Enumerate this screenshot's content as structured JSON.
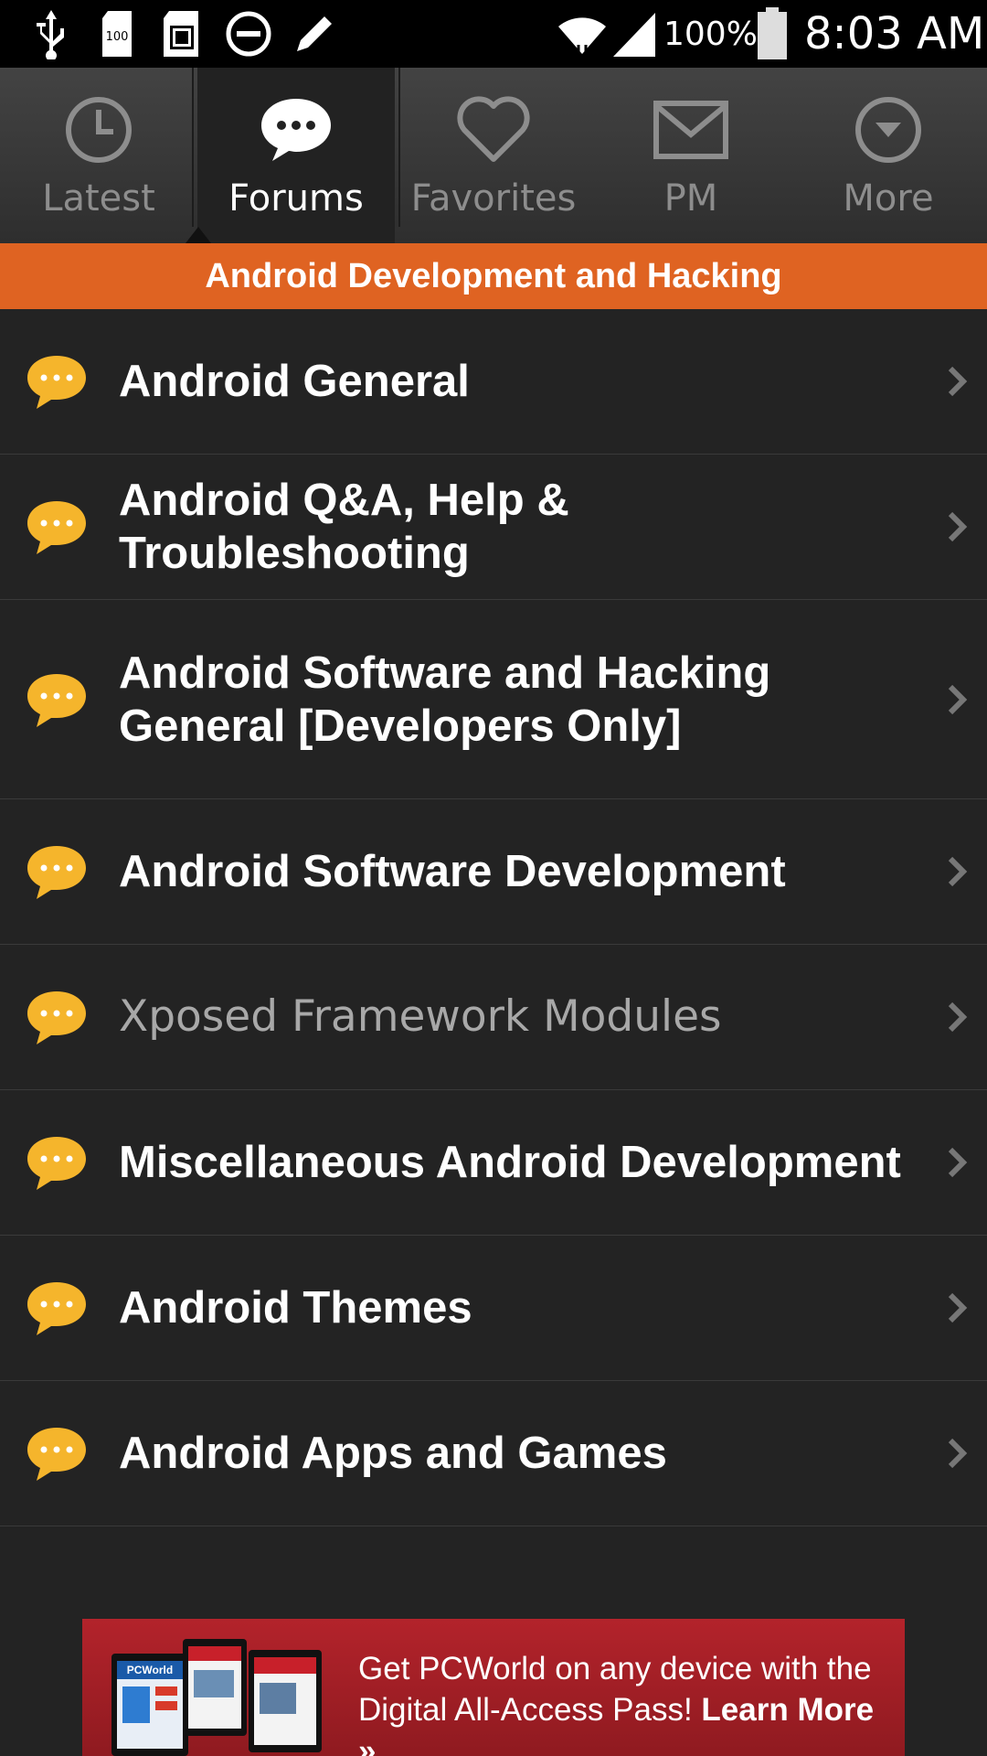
{
  "status_bar": {
    "battery_percent": "100%",
    "time": "8:03 AM",
    "notif_icons": [
      "usb-icon",
      "sd-card-icon",
      "screenshot-icon",
      "do-not-disturb-icon",
      "pencil-icon"
    ],
    "system_icons": [
      "wifi-icon",
      "signal-icon",
      "battery-icon"
    ]
  },
  "tabs": [
    {
      "label": "Latest",
      "icon": "clock-icon",
      "active": false
    },
    {
      "label": "Forums",
      "icon": "chat-bubble-icon",
      "active": true
    },
    {
      "label": "Favorites",
      "icon": "heart-icon",
      "active": false
    },
    {
      "label": "PM",
      "icon": "envelope-icon",
      "active": false
    },
    {
      "label": "More",
      "icon": "dropdown-circle-icon",
      "active": false
    }
  ],
  "section": {
    "title": "Android Development and Hacking"
  },
  "forums": [
    {
      "title": "Android General"
    },
    {
      "title": "Android Q&A, Help & Troubleshooting"
    },
    {
      "title": "Android Software and Hacking General [Developers Only]"
    },
    {
      "title": "Android Software Development"
    },
    {
      "title": "Xposed Framework Modules"
    },
    {
      "title": "Miscellaneous Android Development"
    },
    {
      "title": "Android Themes"
    },
    {
      "title": "Android Apps and Games"
    }
  ],
  "ad": {
    "line1": "Get PCWorld on any device with the",
    "line2_prefix": "Digital All-Access Pass!",
    "cta": "Learn More »",
    "brand": "PCWorld"
  },
  "colors": {
    "accent": "#df6322",
    "background": "#232323",
    "bubble": "#f5b52c",
    "ad_red": "#b3232b"
  }
}
